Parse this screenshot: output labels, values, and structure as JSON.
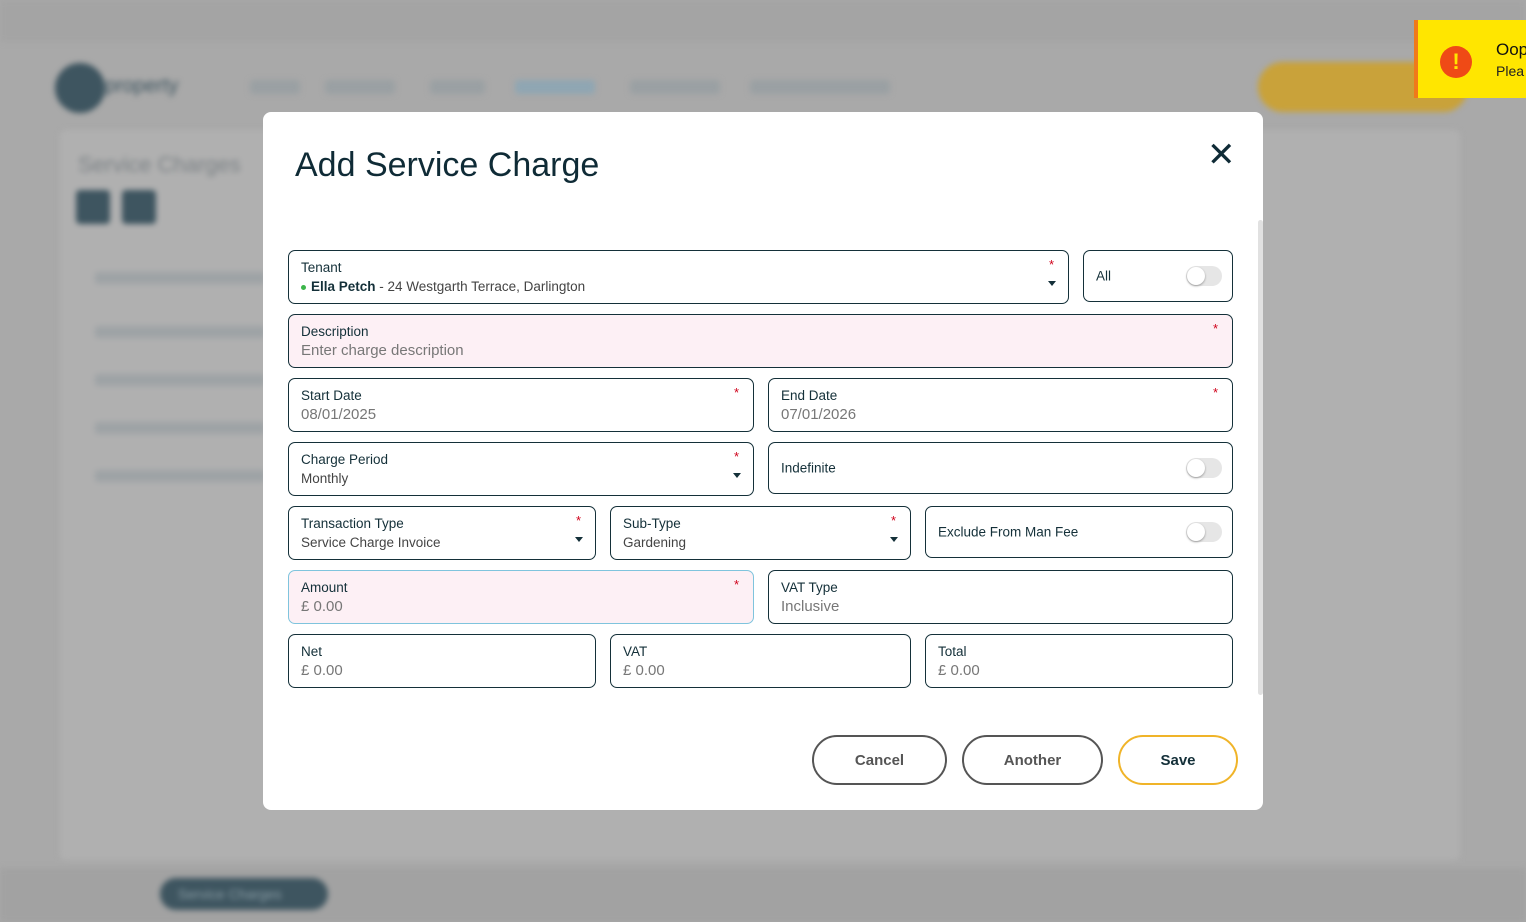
{
  "background": {
    "logo_text": "property",
    "page_title": "Service Charges",
    "bottom_tab": "Service Charges"
  },
  "modal": {
    "title": "Add Service Charge",
    "fields": {
      "tenant": {
        "label": "Tenant",
        "name": "Ella Petch",
        "address": " - 24 Westgarth Terrace, Darlington",
        "required": "*"
      },
      "all": {
        "label": "All",
        "on": false
      },
      "description": {
        "label": "Description",
        "placeholder": "Enter charge description",
        "required": "*"
      },
      "start_date": {
        "label": "Start Date",
        "value": "08/01/2025",
        "required": "*"
      },
      "end_date": {
        "label": "End Date",
        "value": "07/01/2026",
        "required": "*"
      },
      "charge_period": {
        "label": "Charge Period",
        "value": "Monthly",
        "required": "*"
      },
      "indefinite": {
        "label": "Indefinite",
        "on": false
      },
      "transaction_type": {
        "label": "Transaction Type",
        "value": "Service Charge Invoice",
        "required": "*"
      },
      "sub_type": {
        "label": "Sub-Type",
        "value": "Gardening",
        "required": "*"
      },
      "exclude_man_fee": {
        "label": "Exclude From Man Fee",
        "on": false
      },
      "amount": {
        "label": "Amount",
        "value": "£ 0.00",
        "required": "*"
      },
      "vat_type": {
        "label": "VAT Type",
        "value": "Inclusive"
      },
      "net": {
        "label": "Net",
        "value": "£ 0.00"
      },
      "vat": {
        "label": "VAT",
        "value": "£ 0.00"
      },
      "total": {
        "label": "Total",
        "value": "£ 0.00"
      }
    },
    "buttons": {
      "cancel": "Cancel",
      "another": "Another",
      "save": "Save"
    }
  },
  "toast": {
    "title": "Oop",
    "message": "Plea",
    "icon": "exclamation-icon",
    "color": "#ffe600"
  },
  "colors": {
    "primary": "#143039",
    "required": "#d0021b",
    "save_border": "#f0b429",
    "invalid_bg": "#fdf0f5"
  }
}
